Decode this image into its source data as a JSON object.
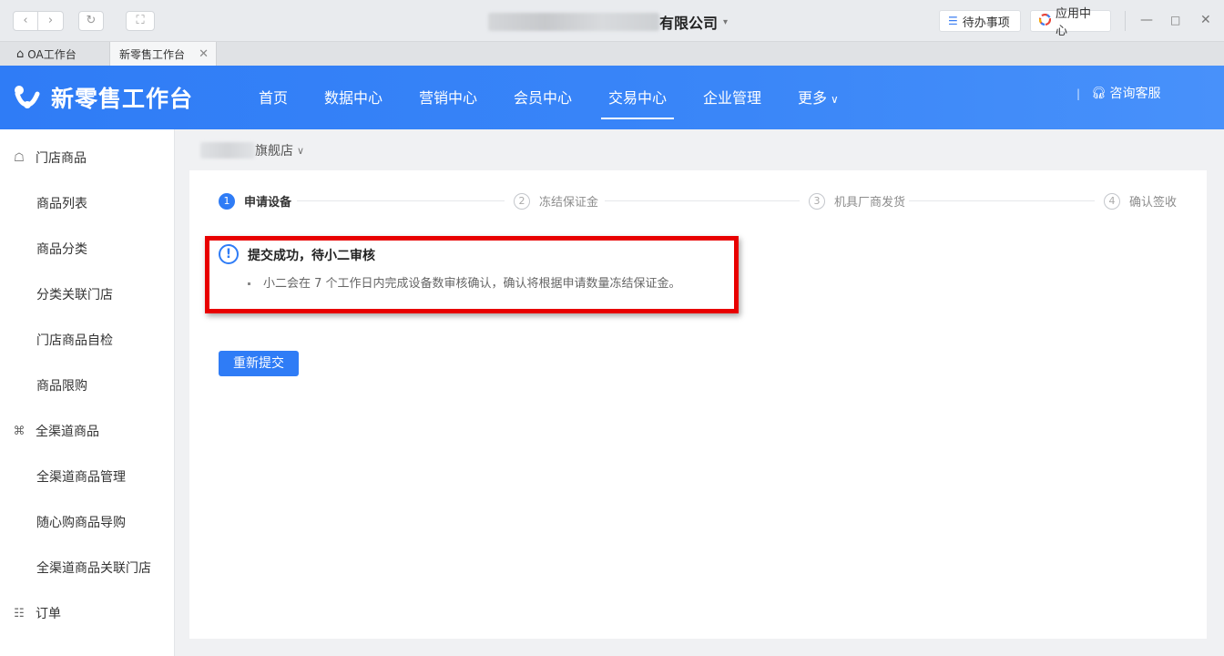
{
  "window": {
    "company_name": "有限公司",
    "todo_label": "待办事项",
    "apps_label": "应用中心"
  },
  "tabs": [
    {
      "label": "OA工作台",
      "icon": "home-icon"
    },
    {
      "label": "新零售工作台"
    }
  ],
  "header": {
    "logo_text": "新零售工作台",
    "nav": [
      "首页",
      "数据中心",
      "营销中心",
      "会员中心",
      "交易中心",
      "企业管理",
      "更多"
    ],
    "active_nav": "交易中心",
    "consult_label": "咨询客服"
  },
  "sidebar": {
    "items": [
      {
        "label": "门店商品",
        "type": "group",
        "icon": "store-goods-icon"
      },
      {
        "label": "商品列表",
        "type": "sub"
      },
      {
        "label": "商品分类",
        "type": "sub"
      },
      {
        "label": "分类关联门店",
        "type": "sub"
      },
      {
        "label": "门店商品自检",
        "type": "sub"
      },
      {
        "label": "商品限购",
        "type": "sub"
      },
      {
        "label": "全渠道商品",
        "type": "group",
        "icon": "omnichannel-icon"
      },
      {
        "label": "全渠道商品管理",
        "type": "sub"
      },
      {
        "label": "随心购商品导购",
        "type": "sub"
      },
      {
        "label": "全渠道商品关联门店",
        "type": "sub"
      },
      {
        "label": "订单",
        "type": "group",
        "icon": "order-icon"
      }
    ]
  },
  "store": {
    "name": "旗舰店"
  },
  "steps": [
    {
      "num": "1",
      "label": "申请设备",
      "active": true
    },
    {
      "num": "2",
      "label": "冻结保证金",
      "active": false
    },
    {
      "num": "3",
      "label": "机具厂商发货",
      "active": false
    },
    {
      "num": "4",
      "label": "确认签收",
      "active": false
    }
  ],
  "notice": {
    "title": "提交成功，待小二审核",
    "body": "小二会在 7 个工作日内完成设备数审核确认，确认将根据申请数量冻结保证金。"
  },
  "actions": {
    "resubmit_label": "重新提交"
  },
  "colors": {
    "primary": "#2f7cf6",
    "highlight": "#e80000"
  }
}
